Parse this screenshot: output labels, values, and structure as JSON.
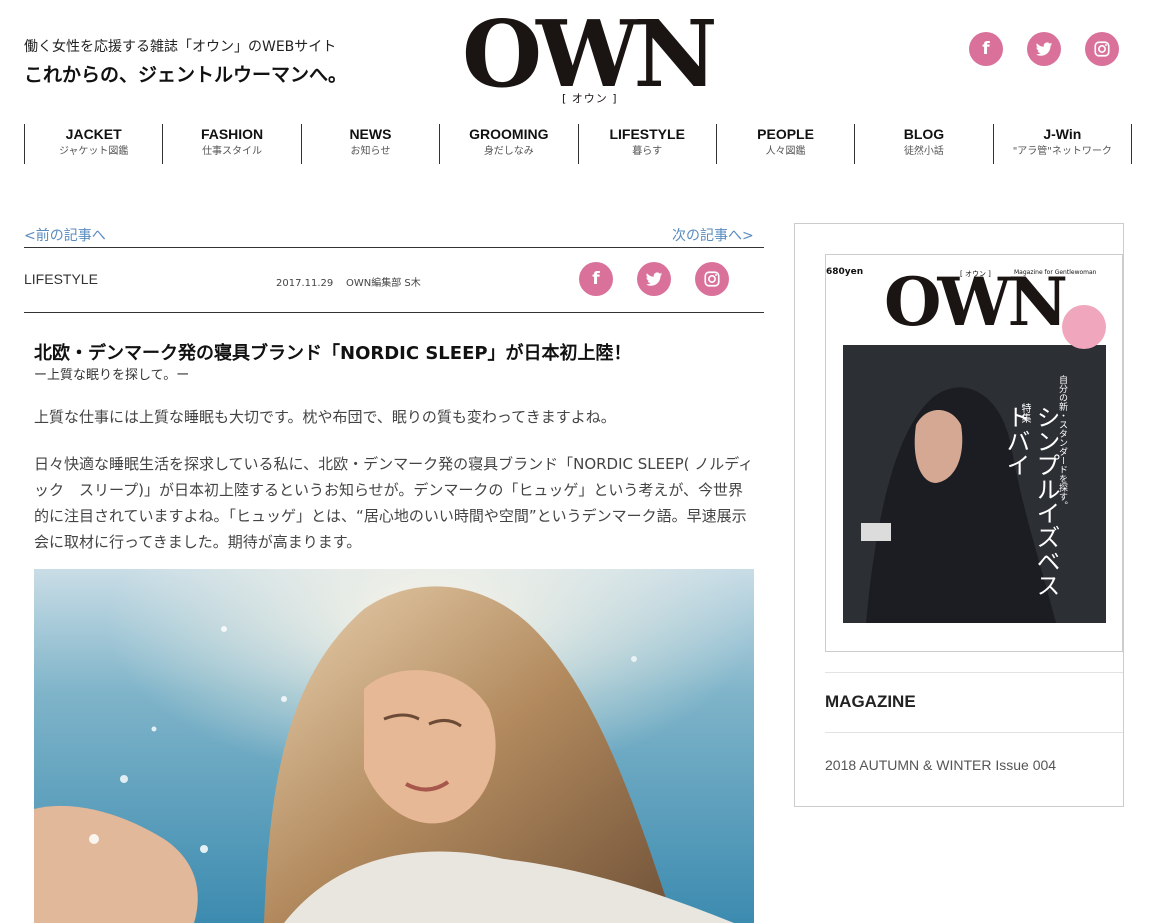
{
  "header": {
    "tagline": "働く女性を応援する雑誌「オウン」のWEBサイト",
    "slogan": "これからの、ジェントルウーマンへ。",
    "logo_text": "OWN",
    "logo_sub": "[ オウン ]",
    "social": [
      {
        "name": "facebook",
        "glyph": "f"
      },
      {
        "name": "twitter",
        "glyph": ""
      },
      {
        "name": "instagram",
        "glyph": ""
      }
    ],
    "accent_color": "#d9719a"
  },
  "nav": [
    {
      "en": "JACKET",
      "jp": "ジャケット図鑑"
    },
    {
      "en": "FASHION",
      "jp": "仕事スタイル"
    },
    {
      "en": "NEWS",
      "jp": "お知らせ"
    },
    {
      "en": "GROOMING",
      "jp": "身だしなみ"
    },
    {
      "en": "LIFESTYLE",
      "jp": "暮らす"
    },
    {
      "en": "PEOPLE",
      "jp": "人々図鑑"
    },
    {
      "en": "BLOG",
      "jp": "徒然小話"
    },
    {
      "en": "J-Win",
      "jp": "\"アラ管\"ネットワーク"
    }
  ],
  "article": {
    "prev_link": "<前の記事へ",
    "next_link": "次の記事へ>",
    "category": "LIFESTYLE",
    "date": "2017.11.29",
    "author": "OWN編集部 S木",
    "title": "北欧・デンマーク発の寝具ブランド「NORDIC SLEEP」が日本初上陸！",
    "subtitle": "ー上質な眠りを探して。ー",
    "para1": "上質な仕事には上質な睡眠も大切です。枕や布団で、眠りの質も変わってきますよね。",
    "para2": "日々快適な睡眠生活を探求している私に、北欧・デンマーク発の寝具ブランド「NORDIC SLEEP( ノルディック　スリープ)」が日本初上陸するというお知らせが。デンマークの「ヒュッゲ」という考えが、今世界的に注目されていますよね。「ヒュッゲ」とは、“居心地のいい時間や空間”というデンマーク語。早速展示会に取材に行ってきました。期待が高まります。"
  },
  "sidebar": {
    "cover": {
      "price": "680yen",
      "logo": "OWN",
      "logo_sub": "[ オウン ]",
      "tag": "Magazine for Gentlewoman",
      "feature_label": "特集",
      "feature_title": "シンプルイズベストバイ",
      "feature_sub": "自分の新・スタンダードを探す。"
    },
    "heading": "MAGAZINE",
    "issue": "2018 AUTUMN & WINTER Issue 004"
  }
}
